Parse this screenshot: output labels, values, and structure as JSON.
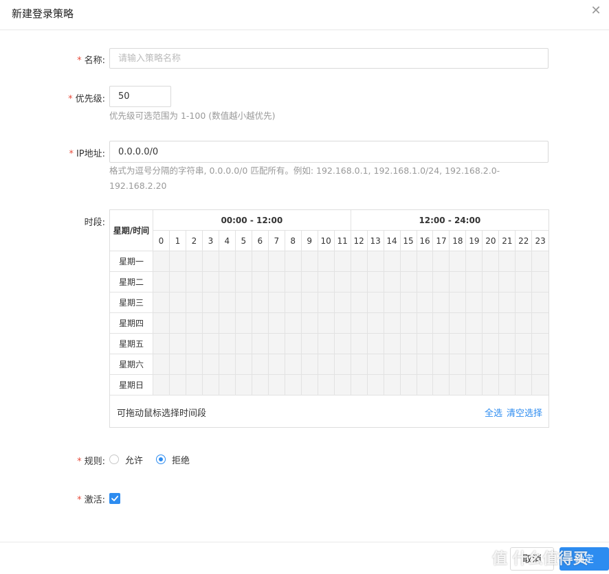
{
  "dialog": {
    "title": "新建登录策略",
    "close_icon": "close-icon"
  },
  "form": {
    "name": {
      "label": "名称:",
      "required_mark": "*",
      "value": "",
      "placeholder": "请输入策略名称"
    },
    "priority": {
      "label": "优先级:",
      "required_mark": "*",
      "value": "50",
      "hint": "优先级可选范围为 1-100 (数值越小越优先)"
    },
    "ip": {
      "label": "IP地址:",
      "required_mark": "*",
      "value": "0.0.0.0/0",
      "hint_line1": "格式为逗号分隔的字符串, 0.0.0.0/0 匹配所有。例如: 192.168.0.1, 192.168.1.0/24, 192.168.2.0-",
      "hint_line2": "192.168.2.20"
    },
    "period": {
      "label": "时段:",
      "header_week": "星期/时间",
      "range_am": "00:00 - 12:00",
      "range_pm": "12:00 - 24:00",
      "hours": [
        "0",
        "1",
        "2",
        "3",
        "4",
        "5",
        "6",
        "7",
        "8",
        "9",
        "10",
        "11",
        "12",
        "13",
        "14",
        "15",
        "16",
        "17",
        "18",
        "19",
        "20",
        "21",
        "22",
        "23"
      ],
      "days": [
        "星期一",
        "星期二",
        "星期三",
        "星期四",
        "星期五",
        "星期六",
        "星期日"
      ],
      "tip": "可拖动鼠标选择时间段",
      "select_all": "全选",
      "clear": "清空选择"
    },
    "rule": {
      "label": "规则:",
      "required_mark": "*",
      "options": [
        "允许",
        "拒绝"
      ],
      "selected": "拒绝"
    },
    "active": {
      "label": "激活:",
      "required_mark": "*",
      "checked": true
    }
  },
  "footer": {
    "cancel": "取消",
    "ok": "确定",
    "watermark": "值 什么值得买"
  },
  "colors": {
    "accent": "#2d8cf0",
    "required": "#e74c3c",
    "slot_bg": "#f4f4f4"
  }
}
